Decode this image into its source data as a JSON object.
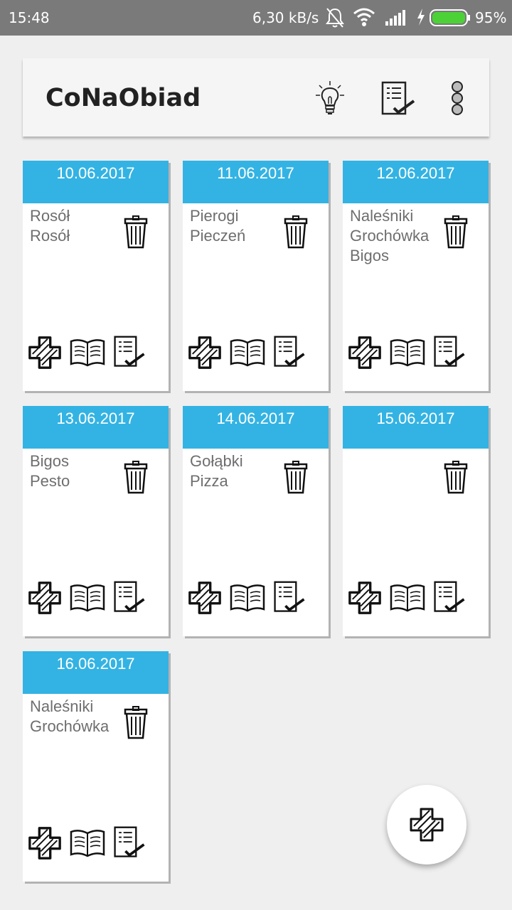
{
  "status_bar": {
    "time": "15:48",
    "speed": "6,30 kB/s",
    "battery": "95%",
    "icons": [
      "mute-icon",
      "wifi-icon",
      "signal-icon",
      "charging-icon",
      "battery-icon"
    ]
  },
  "app_bar": {
    "title": "CoNaObiad",
    "actions": [
      "idea-icon",
      "shopping-list-icon",
      "overflow-menu-icon"
    ]
  },
  "days": [
    {
      "date": "10.06.2017",
      "meals": [
        "Rosół",
        "Rosół"
      ]
    },
    {
      "date": "11.06.2017",
      "meals": [
        "Pierogi",
        "Pieczeń"
      ]
    },
    {
      "date": "12.06.2017",
      "meals": [
        "Naleśniki",
        "Grochówka",
        "Bigos"
      ]
    },
    {
      "date": "13.06.2017",
      "meals": [
        "Bigos",
        "Pesto"
      ]
    },
    {
      "date": "14.06.2017",
      "meals": [
        "Gołąbki",
        "Pizza"
      ]
    },
    {
      "date": "15.06.2017",
      "meals": []
    },
    {
      "date": "16.06.2017",
      "meals": [
        "Naleśniki",
        "Grochówka"
      ]
    }
  ],
  "card_actions": [
    "add-icon",
    "recipe-book-icon",
    "shopping-list-icon"
  ],
  "colors": {
    "accent": "#33b3e3",
    "status_bar": "#7a7a7a",
    "background": "#efefef",
    "meal_text": "#6e6e6e"
  },
  "fab": {
    "icon": "add-icon"
  }
}
